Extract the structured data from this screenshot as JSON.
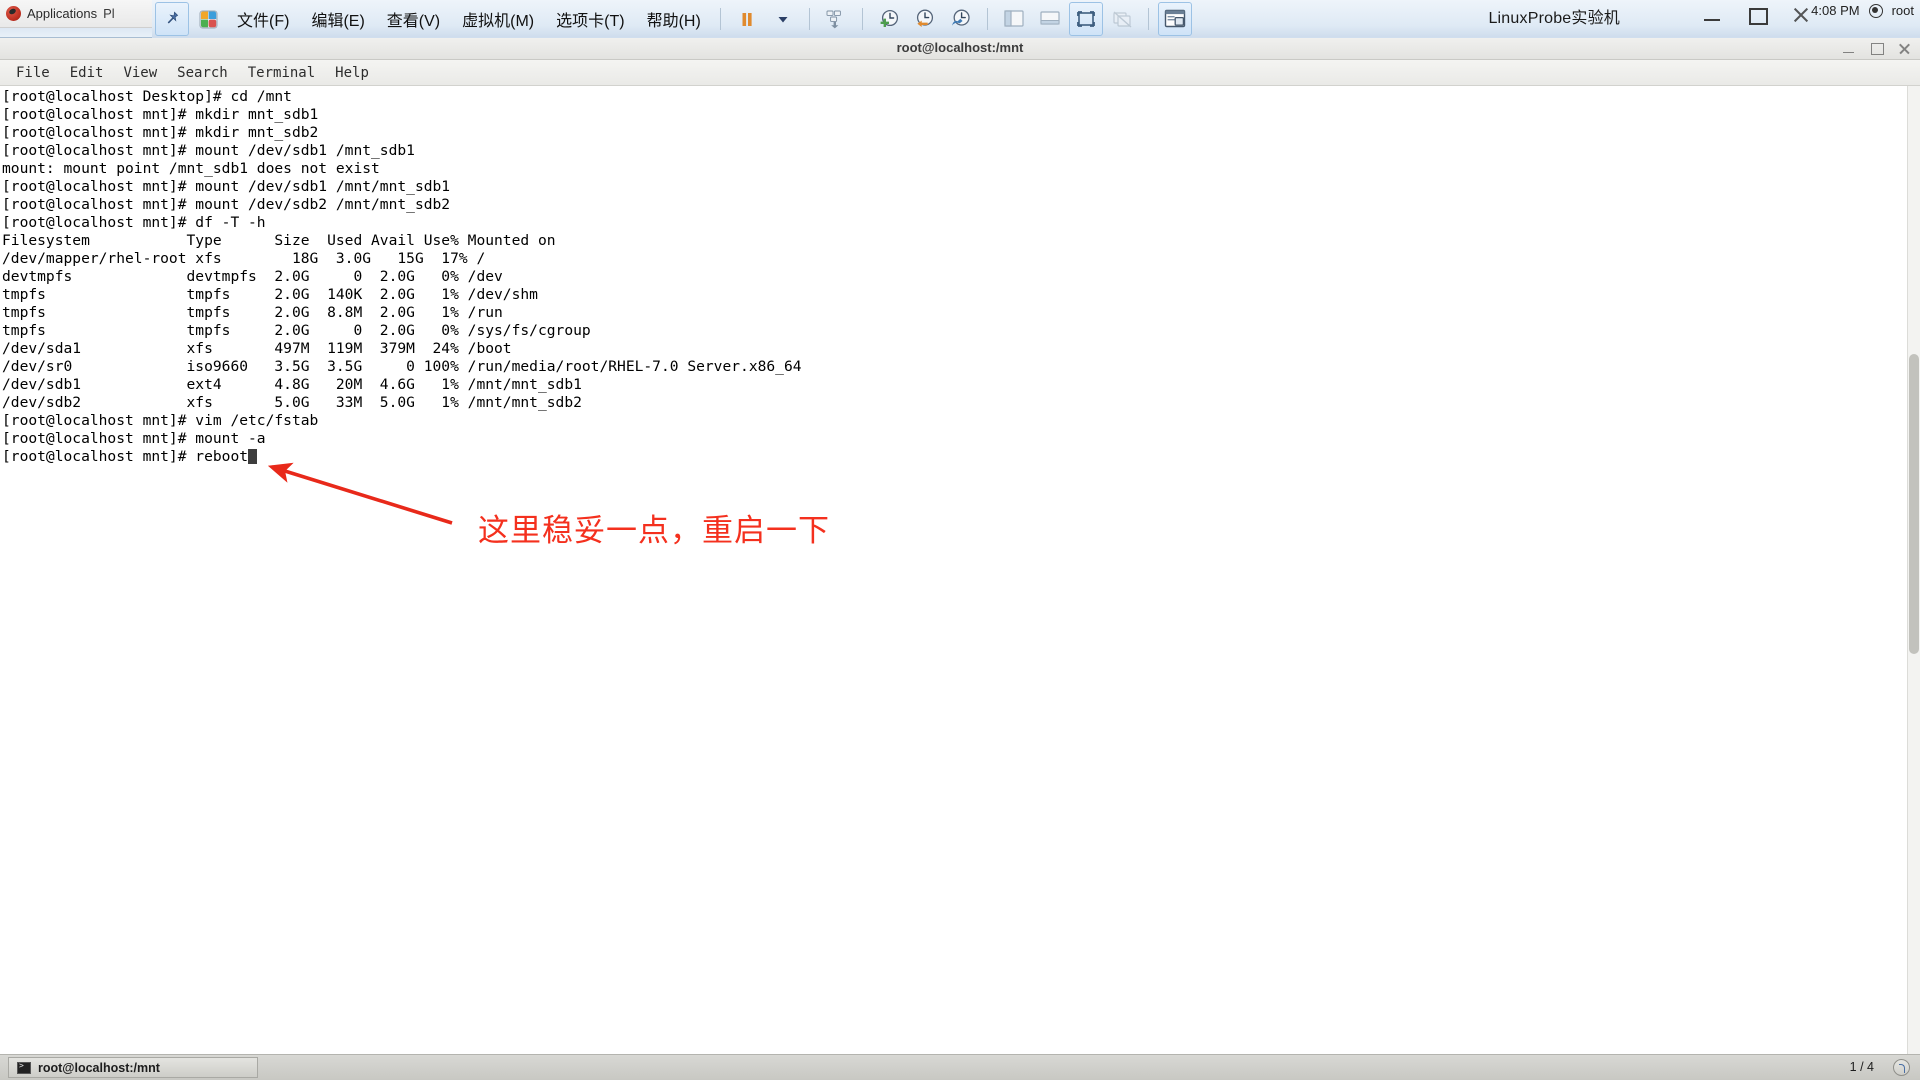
{
  "gnome_panel": {
    "applications_label": "Applications",
    "places_label": "Pl",
    "logo_icon": "redhat-logo-icon"
  },
  "vmware": {
    "menus": [
      {
        "label": "文件(F)",
        "name": "menu-file"
      },
      {
        "label": "编辑(E)",
        "name": "menu-edit"
      },
      {
        "label": "查看(V)",
        "name": "menu-view"
      },
      {
        "label": "虚拟机(M)",
        "name": "menu-vm"
      },
      {
        "label": "选项卡(T)",
        "name": "menu-tabs"
      },
      {
        "label": "帮助(H)",
        "name": "menu-help"
      }
    ],
    "window_title": "LinuxProbe实验机",
    "toolbar_icons": [
      "pin-icon",
      "vm-library-icon",
      "pause-icon",
      "power-dropdown-icon",
      "send-ctrl-alt-del-icon",
      "take-snapshot-icon",
      "revert-snapshot-icon",
      "snapshot-manager-icon",
      "show-library-icon",
      "show-thumbnails-icon",
      "full-screen-icon",
      "unity-mode-icon",
      "console-view-icon"
    ],
    "window_controls": [
      "minimize-icon",
      "maximize-icon",
      "close-icon"
    ],
    "tray": {
      "clock": "4:08 PM",
      "user": "root"
    }
  },
  "guest_window": {
    "title": "root@localhost:/mnt",
    "controls": [
      "minimize-icon",
      "maximize-icon",
      "close-icon"
    ]
  },
  "terminal": {
    "menus": [
      "File",
      "Edit",
      "View",
      "Search",
      "Terminal",
      "Help"
    ],
    "lines": [
      "[root@localhost Desktop]# cd /mnt",
      "[root@localhost mnt]# mkdir mnt_sdb1",
      "[root@localhost mnt]# mkdir mnt_sdb2",
      "[root@localhost mnt]# mount /dev/sdb1 /mnt_sdb1",
      "mount: mount point /mnt_sdb1 does not exist",
      "[root@localhost mnt]# mount /dev/sdb1 /mnt/mnt_sdb1",
      "[root@localhost mnt]# mount /dev/sdb2 /mnt/mnt_sdb2",
      "[root@localhost mnt]# df -T -h",
      "Filesystem           Type      Size  Used Avail Use% Mounted on",
      "/dev/mapper/rhel-root xfs        18G  3.0G   15G  17% /",
      "devtmpfs             devtmpfs  2.0G     0  2.0G   0% /dev",
      "tmpfs                tmpfs     2.0G  140K  2.0G   1% /dev/shm",
      "tmpfs                tmpfs     2.0G  8.8M  2.0G   1% /run",
      "tmpfs                tmpfs     2.0G     0  2.0G   0% /sys/fs/cgroup",
      "/dev/sda1            xfs       497M  119M  379M  24% /boot",
      "/dev/sr0             iso9660   3.5G  3.5G     0 100% /run/media/root/RHEL-7.0 Server.x86_64",
      "/dev/sdb1            ext4      4.8G   20M  4.6G   1% /mnt/mnt_sdb1",
      "/dev/sdb2            xfs       5.0G   33M  5.0G   1% /mnt/mnt_sdb2",
      "[root@localhost mnt]# vim /etc/fstab",
      "[root@localhost mnt]# mount -a"
    ],
    "last_prompt": "[root@localhost mnt]# reboot",
    "cursor": "block-cursor"
  },
  "annotation": {
    "text": "这里稳妥一点，重启一下",
    "color": "#f4301e",
    "arrow": "red-arrow-icon"
  },
  "taskbar": {
    "window_button": "root@localhost:/mnt",
    "workspace_indicator": "1 / 4"
  }
}
